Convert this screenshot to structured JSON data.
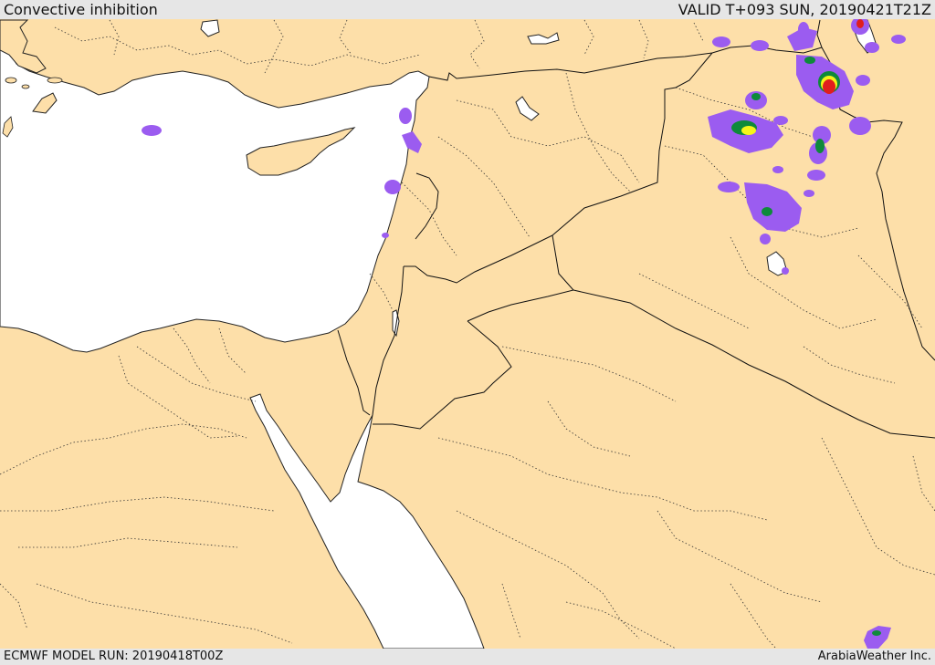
{
  "header": {
    "title": "Convective inhibition",
    "valid": "VALID T+093 SUN, 20190421T21Z"
  },
  "footer": {
    "run": "ECMWF MODEL RUN: 20190418T00Z",
    "credit": "ArabiaWeather Inc."
  },
  "colors": {
    "land": "#fddfa9",
    "sea": "#ffffff",
    "border": "#111111",
    "cin_low": "#9b5cf0",
    "cin_mid": "#0e8a3a",
    "cin_high": "#f5f51a",
    "cin_max": "#e01e1e"
  }
}
